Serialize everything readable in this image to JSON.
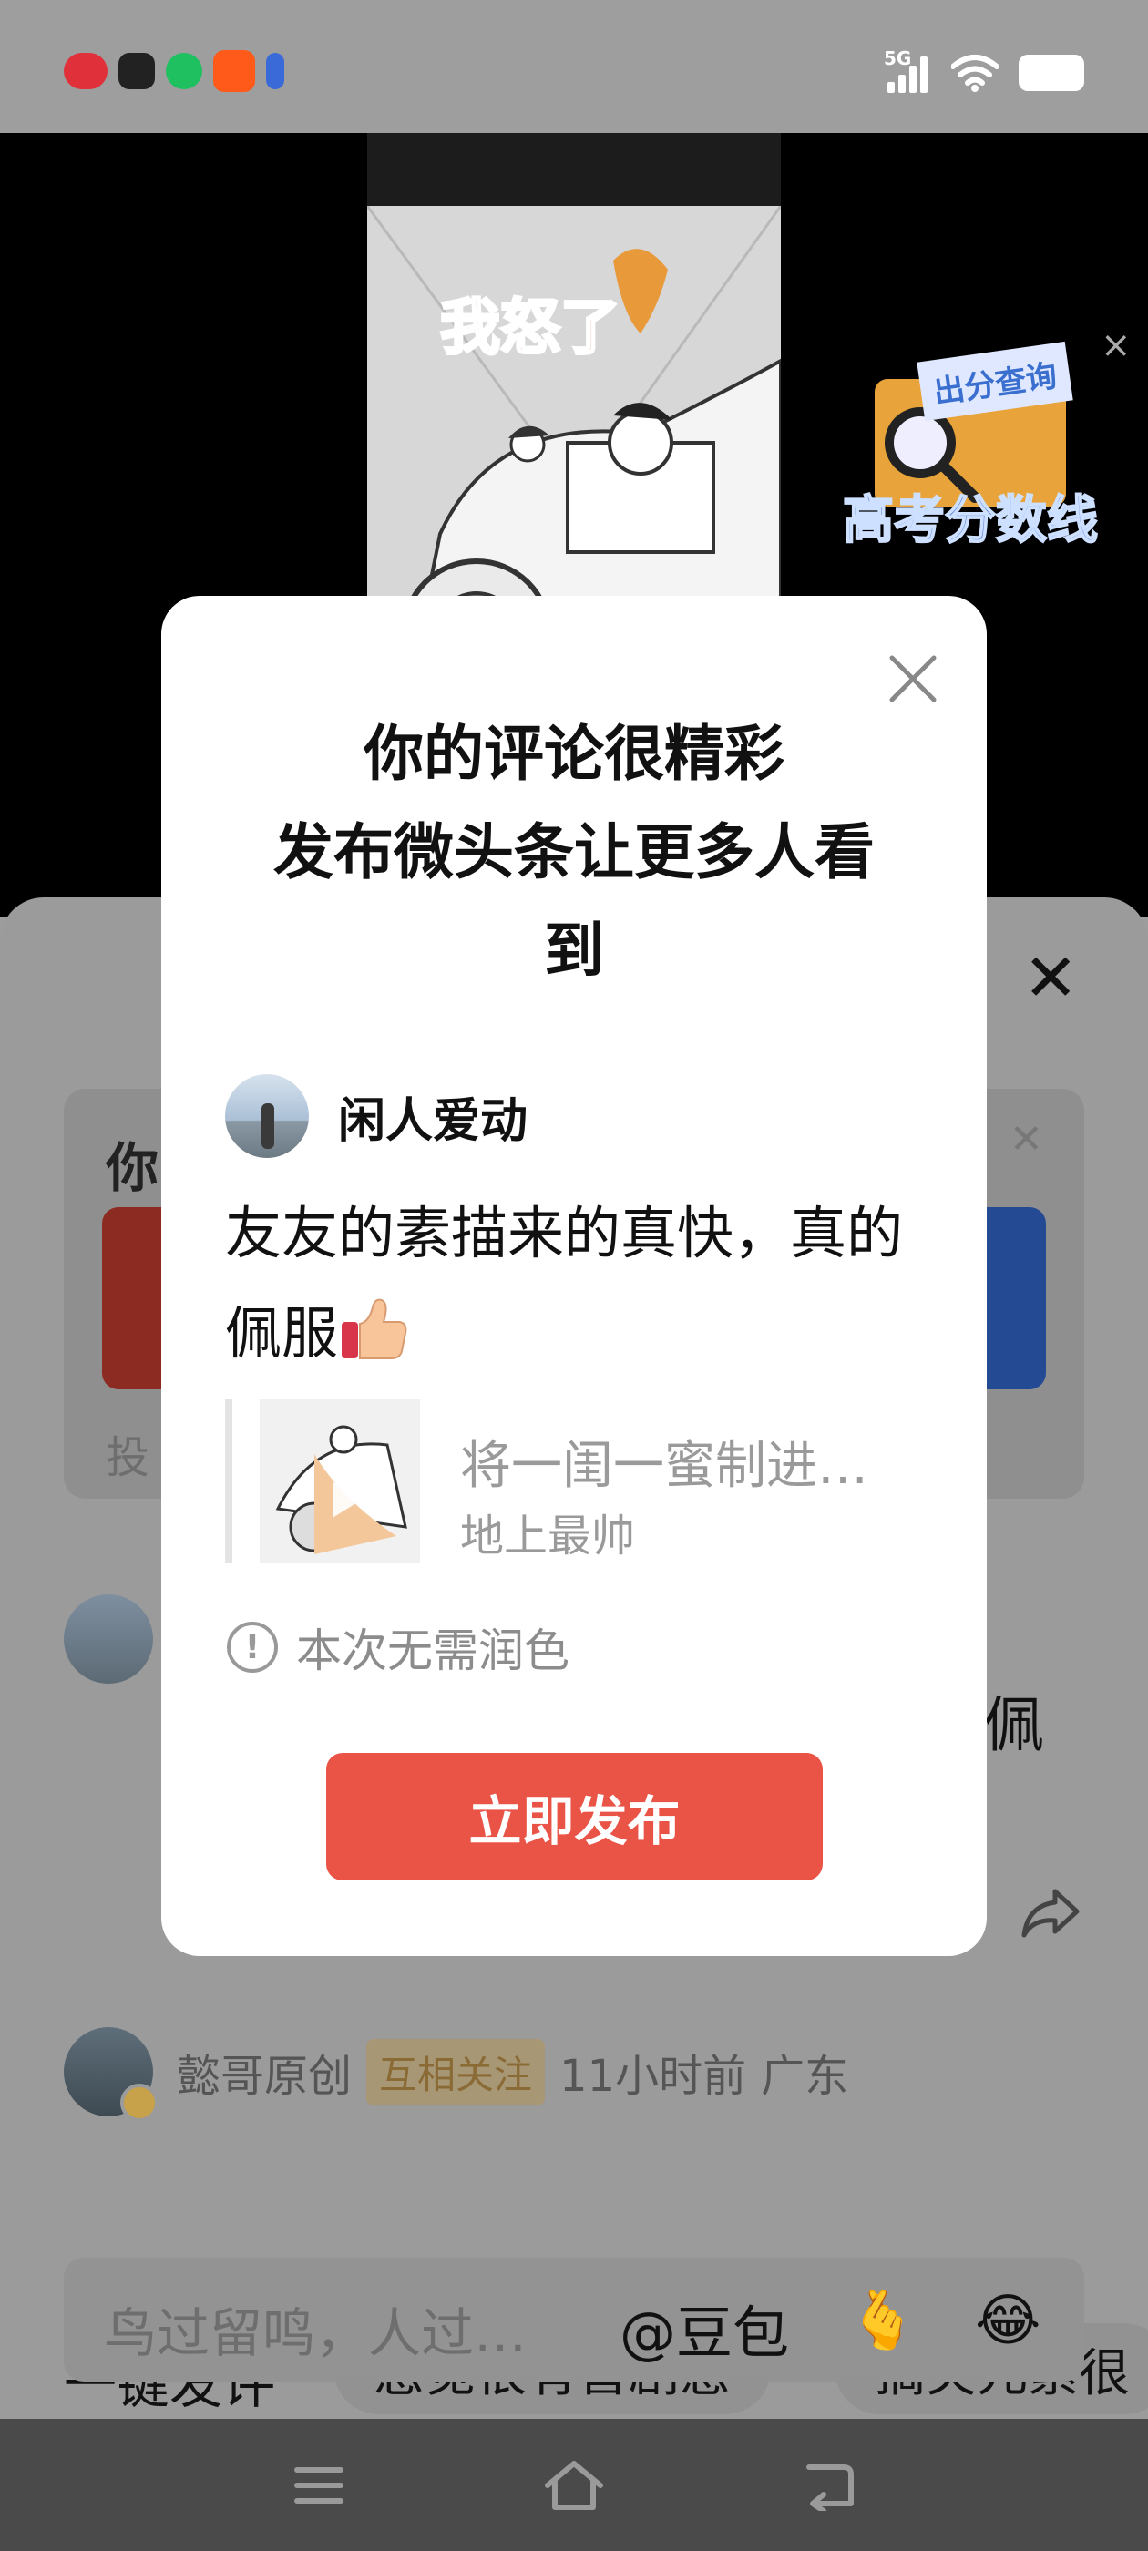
{
  "status_bar": {
    "network": "5G",
    "blurred_notification_colors": [
      "#e0303a",
      "#222222",
      "#1fc060",
      "#ff5a1a",
      "#3a6ad8"
    ]
  },
  "video": {
    "comic_title": "我怒了",
    "ad": {
      "tag": "出分查询",
      "text": "高考分数线",
      "close_icon": "close-icon"
    }
  },
  "comment_sheet": {
    "promo": {
      "title": "你",
      "footer": "投"
    },
    "comment1_tail": "佩",
    "comment2": {
      "name": "懿哥原创",
      "tag": "互相关注",
      "time": "11小时前",
      "location": "广东"
    },
    "quick_reply": {
      "label": "一键发评",
      "chips": [
        "感觉很有喜剧感",
        "搞笑元素很"
      ]
    },
    "input": {
      "placeholder": "鸟过留鸣，人过…",
      "mention": "@豆包",
      "emojis": [
        "🫰",
        "😂"
      ]
    }
  },
  "modal": {
    "title_line1": "你的评论很精彩",
    "title_line2": "发布微头条让更多人看",
    "title_line3": "到",
    "author": "闲人爱动",
    "comment": "友友的素描来的真快，真的佩服",
    "quote_title": "将一闺一蜜制进…",
    "quote_author": "地上最帅",
    "notice": "本次无需润色",
    "publish_label": "立即发布"
  },
  "colors": {
    "accent_red": "#ea5447",
    "overlay_gray": "#9b9b9b"
  }
}
